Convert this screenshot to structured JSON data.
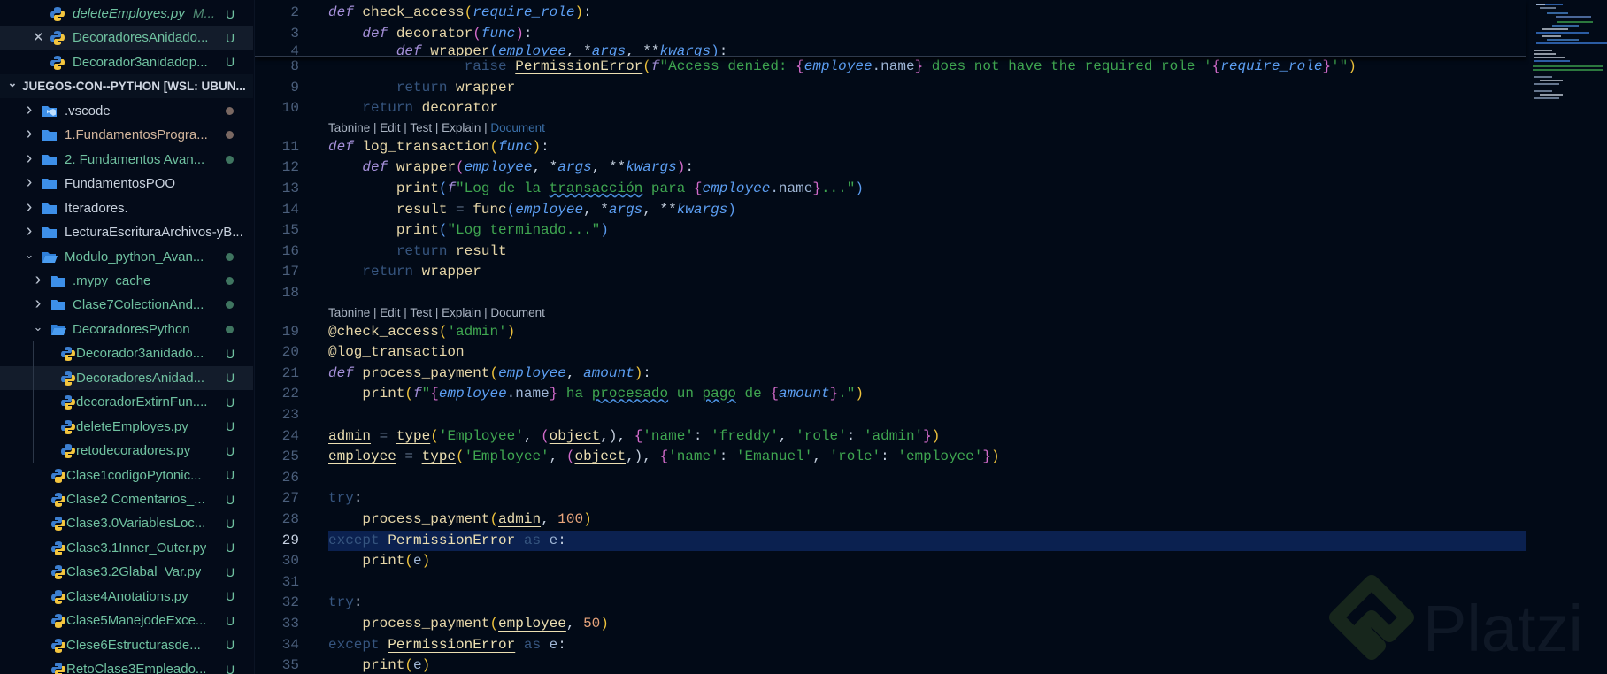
{
  "sidebar": {
    "open_editors": [
      {
        "label": "deleteEmployes.py",
        "hint": "M...",
        "badge": "U",
        "italic": true
      },
      {
        "label": "DecoradoresAnidado...",
        "badge": "U",
        "close": true,
        "selected": true
      },
      {
        "label": "Decorador3anidadop...",
        "badge": "U"
      }
    ],
    "workspace_title": "JUEGOS-CON--PYTHON [WSL: UBUN...",
    "tree": [
      {
        "label": ".vscode",
        "type": "vscode",
        "level": 1,
        "dot": "#7a6862",
        "color": "#c9d2de"
      },
      {
        "label": "1.FundamentosProgra...",
        "type": "folder",
        "level": 1,
        "dot": "#7a6862",
        "color": "#d2b59c"
      },
      {
        "label": "2. Fundamentos Avan...",
        "type": "folder",
        "level": 1,
        "dot": "#3f7560"
      },
      {
        "label": "FundamentosPOO",
        "type": "folder",
        "level": 1,
        "color": "#c9d2de"
      },
      {
        "label": "Iteradores.",
        "type": "folder",
        "level": 1,
        "color": "#c9d2de"
      },
      {
        "label": "LecturaEscrituraArchivos-yB...",
        "type": "folder",
        "level": 1,
        "color": "#c9d2de"
      },
      {
        "label": "Modulo_python_Avan...",
        "type": "folder",
        "level": 1,
        "open": true,
        "dot": "#3f7560"
      },
      {
        "label": ".mypy_cache",
        "type": "folder",
        "level": 2,
        "dot": "#3f7560"
      },
      {
        "label": "Clase7ColectionAnd...",
        "type": "folder",
        "level": 2,
        "dot": "#3f7560"
      },
      {
        "label": "DecoradoresPython",
        "type": "folder",
        "level": 2,
        "open": true,
        "dot": "#3f7560"
      },
      {
        "label": "Decorador3anidado...",
        "type": "py",
        "level": 3,
        "badge": "U"
      },
      {
        "label": "DecoradoresAnidad...",
        "type": "py",
        "level": 3,
        "badge": "U",
        "selected": true
      },
      {
        "label": "decoradorExtirnFun....",
        "type": "py",
        "level": 3,
        "badge": "U"
      },
      {
        "label": "deleteEmployes.py",
        "type": "py",
        "level": 3,
        "badge": "U"
      },
      {
        "label": "retodecoradores.py",
        "type": "py",
        "level": 3,
        "badge": "U"
      },
      {
        "label": "Clase1codigoPytonic...",
        "type": "py",
        "level": 2,
        "badge": "U"
      },
      {
        "label": "Clase2 Comentarios_...",
        "type": "py",
        "level": 2,
        "badge": "U"
      },
      {
        "label": "Clase3.0VariablesLoc...",
        "type": "py",
        "level": 2,
        "badge": "U"
      },
      {
        "label": "Clase3.1Inner_Outer.py",
        "type": "py",
        "level": 2,
        "badge": "U"
      },
      {
        "label": "Clase3.2Glabal_Var.py",
        "type": "py",
        "level": 2,
        "badge": "U"
      },
      {
        "label": "Clase4Anotations.py",
        "type": "py",
        "level": 2,
        "badge": "U"
      },
      {
        "label": "Clase5ManejodeExce...",
        "type": "py",
        "level": 2,
        "badge": "U"
      },
      {
        "label": "Clese6Estructurasde...",
        "type": "py",
        "level": 2,
        "badge": "U"
      },
      {
        "label": "RetoClase3Empleado...",
        "type": "py",
        "level": 2,
        "badge": "U"
      }
    ]
  },
  "editor": {
    "active_line": "29",
    "sticky": [
      {
        "n": "2",
        "tokens": [
          [
            "k",
            "def"
          ],
          [
            "t",
            " "
          ],
          [
            "f",
            "check_access"
          ],
          [
            "y",
            "("
          ],
          [
            "p",
            "require_role"
          ],
          [
            "y",
            ")"
          ],
          [
            "t",
            ":"
          ]
        ]
      },
      {
        "n": "3",
        "tokens": [
          [
            "t",
            "    "
          ],
          [
            "k",
            "def"
          ],
          [
            "t",
            " "
          ],
          [
            "f",
            "decorator"
          ],
          [
            "m",
            "("
          ],
          [
            "p",
            "func"
          ],
          [
            "m",
            ")"
          ],
          [
            "t",
            ":"
          ]
        ]
      },
      {
        "n": "4",
        "tokens": [
          [
            "t",
            "        "
          ],
          [
            "k",
            "def"
          ],
          [
            "t",
            " "
          ],
          [
            "f",
            "wrapper"
          ],
          [
            "b",
            "("
          ],
          [
            "p",
            "employee"
          ],
          [
            "t",
            ", *"
          ],
          [
            "p",
            "args"
          ],
          [
            "t",
            ", **"
          ],
          [
            "p",
            "kwargs"
          ],
          [
            "b",
            ")"
          ],
          [
            "t",
            ":"
          ]
        ]
      }
    ],
    "rows": [
      {
        "n": "8",
        "tokens": [
          [
            "t",
            "                "
          ],
          [
            "r",
            "raise"
          ],
          [
            "t",
            " "
          ],
          [
            "u",
            "PermissionError"
          ],
          [
            "y",
            "("
          ],
          [
            "k",
            "f"
          ],
          [
            "s",
            "\"Access denied: "
          ],
          [
            "m",
            "{"
          ],
          [
            "p",
            "employee"
          ],
          [
            "a",
            ".name"
          ],
          [
            "m",
            "}"
          ],
          [
            "s",
            " does not have the required role '"
          ],
          [
            "m",
            "{"
          ],
          [
            "p",
            "require_role"
          ],
          [
            "m",
            "}"
          ],
          [
            "s",
            "'\""
          ],
          [
            "y",
            ")"
          ]
        ]
      },
      {
        "n": "9",
        "tokens": [
          [
            "t",
            "        "
          ],
          [
            "r",
            "return"
          ],
          [
            "t",
            " "
          ],
          [
            "f",
            "wrapper"
          ]
        ]
      },
      {
        "n": "10",
        "tokens": [
          [
            "t",
            "    "
          ],
          [
            "r",
            "return"
          ],
          [
            "t",
            " "
          ],
          [
            "f",
            "decorator"
          ]
        ]
      },
      {
        "lens": [
          "Tabnine | Edit | Test | Explain | ",
          "Document"
        ]
      },
      {
        "n": "11",
        "tokens": [
          [
            "k",
            "def"
          ],
          [
            "t",
            " "
          ],
          [
            "f",
            "log_transaction"
          ],
          [
            "y",
            "("
          ],
          [
            "p",
            "func"
          ],
          [
            "y",
            ")"
          ],
          [
            "t",
            ":"
          ]
        ]
      },
      {
        "n": "12",
        "tokens": [
          [
            "t",
            "    "
          ],
          [
            "k",
            "def"
          ],
          [
            "t",
            " "
          ],
          [
            "f",
            "wrapper"
          ],
          [
            "m",
            "("
          ],
          [
            "p",
            "employee"
          ],
          [
            "t",
            ", *"
          ],
          [
            "p",
            "args"
          ],
          [
            "t",
            ", **"
          ],
          [
            "p",
            "kwargs"
          ],
          [
            "m",
            ")"
          ],
          [
            "t",
            ":"
          ]
        ]
      },
      {
        "n": "13",
        "tokens": [
          [
            "t",
            "        "
          ],
          [
            "f",
            "print"
          ],
          [
            "b",
            "("
          ],
          [
            "k",
            "f"
          ],
          [
            "s",
            "\"Log de la "
          ],
          [
            "w",
            "transacción"
          ],
          [
            "s",
            " para "
          ],
          [
            "m",
            "{"
          ],
          [
            "p",
            "employee"
          ],
          [
            "a",
            ".name"
          ],
          [
            "m",
            "}"
          ],
          [
            "s",
            "...\""
          ],
          [
            "b",
            ")"
          ]
        ]
      },
      {
        "n": "14",
        "tokens": [
          [
            "t",
            "        "
          ],
          [
            "f",
            "result"
          ],
          [
            "o",
            " = "
          ],
          [
            "f",
            "func"
          ],
          [
            "b",
            "("
          ],
          [
            "p",
            "employee"
          ],
          [
            "t",
            ", *"
          ],
          [
            "p",
            "args"
          ],
          [
            "t",
            ", **"
          ],
          [
            "p",
            "kwargs"
          ],
          [
            "b",
            ")"
          ]
        ]
      },
      {
        "n": "15",
        "tokens": [
          [
            "t",
            "        "
          ],
          [
            "f",
            "print"
          ],
          [
            "b",
            "("
          ],
          [
            "s",
            "\"Log terminado...\""
          ],
          [
            "b",
            ")"
          ]
        ]
      },
      {
        "n": "16",
        "tokens": [
          [
            "t",
            "        "
          ],
          [
            "r",
            "return"
          ],
          [
            "t",
            " "
          ],
          [
            "f",
            "result"
          ]
        ]
      },
      {
        "n": "17",
        "tokens": [
          [
            "t",
            "    "
          ],
          [
            "r",
            "return"
          ],
          [
            "t",
            " "
          ],
          [
            "f",
            "wrapper"
          ]
        ]
      },
      {
        "n": "18",
        "tokens": []
      },
      {
        "lens": [
          "Tabnine | Edit | Test | Explain | Document",
          ""
        ]
      },
      {
        "n": "19",
        "tokens": [
          [
            "f",
            "@check_access"
          ],
          [
            "y",
            "("
          ],
          [
            "s",
            "'admin'"
          ],
          [
            "y",
            ")"
          ]
        ]
      },
      {
        "n": "20",
        "tokens": [
          [
            "f",
            "@log_transaction"
          ]
        ]
      },
      {
        "n": "21",
        "tokens": [
          [
            "k",
            "def"
          ],
          [
            "t",
            " "
          ],
          [
            "f",
            "process_payment"
          ],
          [
            "y",
            "("
          ],
          [
            "p",
            "employee"
          ],
          [
            "t",
            ", "
          ],
          [
            "p",
            "amount"
          ],
          [
            "y",
            ")"
          ],
          [
            "t",
            ":"
          ]
        ]
      },
      {
        "n": "22",
        "tokens": [
          [
            "t",
            "    "
          ],
          [
            "f",
            "print"
          ],
          [
            "y",
            "("
          ],
          [
            "k",
            "f"
          ],
          [
            "s",
            "\""
          ],
          [
            "m",
            "{"
          ],
          [
            "p",
            "employee"
          ],
          [
            "a",
            ".name"
          ],
          [
            "m",
            "}"
          ],
          [
            "s",
            " ha "
          ],
          [
            "w",
            "procesado"
          ],
          [
            "s",
            " un "
          ],
          [
            "w",
            "pago"
          ],
          [
            "s",
            " de "
          ],
          [
            "m",
            "{"
          ],
          [
            "p",
            "amount"
          ],
          [
            "m",
            "}"
          ],
          [
            "s",
            ".\""
          ],
          [
            "y",
            ")"
          ]
        ]
      },
      {
        "n": "23",
        "tokens": []
      },
      {
        "n": "24",
        "tokens": [
          [
            "u",
            "admin"
          ],
          [
            "o",
            " = "
          ],
          [
            "u",
            "type"
          ],
          [
            "y",
            "("
          ],
          [
            "s",
            "'Employee'"
          ],
          [
            "t",
            ", "
          ],
          [
            "m",
            "("
          ],
          [
            "u",
            "object"
          ],
          [
            "t",
            ",)"
          ],
          [
            "m",
            ""
          ],
          [
            "t",
            ", "
          ],
          [
            "m",
            "{"
          ],
          [
            "s",
            "'name'"
          ],
          [
            "t",
            ": "
          ],
          [
            "s",
            "'freddy'"
          ],
          [
            "t",
            ", "
          ],
          [
            "s",
            "'role'"
          ],
          [
            "t",
            ": "
          ],
          [
            "s",
            "'admin'"
          ],
          [
            "m",
            "}"
          ],
          [
            "y",
            ")"
          ]
        ]
      },
      {
        "n": "25",
        "tokens": [
          [
            "u",
            "employee"
          ],
          [
            "o",
            " = "
          ],
          [
            "u",
            "type"
          ],
          [
            "y",
            "("
          ],
          [
            "s",
            "'Employee'"
          ],
          [
            "t",
            ", "
          ],
          [
            "m",
            "("
          ],
          [
            "u",
            "object"
          ],
          [
            "t",
            ",)"
          ],
          [
            "m",
            ""
          ],
          [
            "t",
            ", "
          ],
          [
            "m",
            "{"
          ],
          [
            "s",
            "'name'"
          ],
          [
            "t",
            ": "
          ],
          [
            "s",
            "'Emanuel'"
          ],
          [
            "t",
            ", "
          ],
          [
            "s",
            "'role'"
          ],
          [
            "t",
            ": "
          ],
          [
            "s",
            "'employee'"
          ],
          [
            "m",
            "}"
          ],
          [
            "y",
            ")"
          ]
        ]
      },
      {
        "n": "26",
        "tokens": []
      },
      {
        "n": "27",
        "tokens": [
          [
            "r",
            "try"
          ],
          [
            "t",
            ":"
          ]
        ]
      },
      {
        "n": "28",
        "tokens": [
          [
            "t",
            "    "
          ],
          [
            "f",
            "process_payment"
          ],
          [
            "y",
            "("
          ],
          [
            "u",
            "admin"
          ],
          [
            "t",
            ", "
          ],
          [
            "n",
            "100"
          ],
          [
            "y",
            ")"
          ]
        ]
      },
      {
        "n": "29",
        "tokens": [
          [
            "r",
            "except"
          ],
          [
            "t",
            " "
          ],
          [
            "u",
            "PermissionError"
          ],
          [
            "t",
            " "
          ],
          [
            "r",
            "as"
          ],
          [
            "t",
            " "
          ],
          [
            "a",
            "e"
          ],
          [
            "t",
            ":"
          ]
        ]
      },
      {
        "n": "30",
        "tokens": [
          [
            "t",
            "    "
          ],
          [
            "f",
            "print"
          ],
          [
            "y",
            "("
          ],
          [
            "a",
            "e"
          ],
          [
            "y",
            ")"
          ]
        ]
      },
      {
        "n": "31",
        "tokens": []
      },
      {
        "n": "32",
        "tokens": [
          [
            "r",
            "try"
          ],
          [
            "t",
            ":"
          ]
        ]
      },
      {
        "n": "33",
        "tokens": [
          [
            "t",
            "    "
          ],
          [
            "f",
            "process_payment"
          ],
          [
            "y",
            "("
          ],
          [
            "u",
            "employee"
          ],
          [
            "t",
            ", "
          ],
          [
            "n",
            "50"
          ],
          [
            "y",
            ")"
          ]
        ]
      },
      {
        "n": "34",
        "tokens": [
          [
            "r",
            "except"
          ],
          [
            "t",
            " "
          ],
          [
            "u",
            "PermissionError"
          ],
          [
            "t",
            " "
          ],
          [
            "r",
            "as"
          ],
          [
            "t",
            " "
          ],
          [
            "a",
            "e"
          ],
          [
            "t",
            ":"
          ]
        ]
      },
      {
        "n": "35",
        "tokens": [
          [
            "t",
            "    "
          ],
          [
            "f",
            "print"
          ],
          [
            "y",
            "("
          ],
          [
            "a",
            "e"
          ],
          [
            "y",
            ")"
          ]
        ]
      }
    ]
  },
  "watermark": {
    "brand": "Platzi"
  },
  "colors": {
    "accent": "#0b2150",
    "folder": "#3d8fe8",
    "untracked": "#6fc1a0"
  }
}
